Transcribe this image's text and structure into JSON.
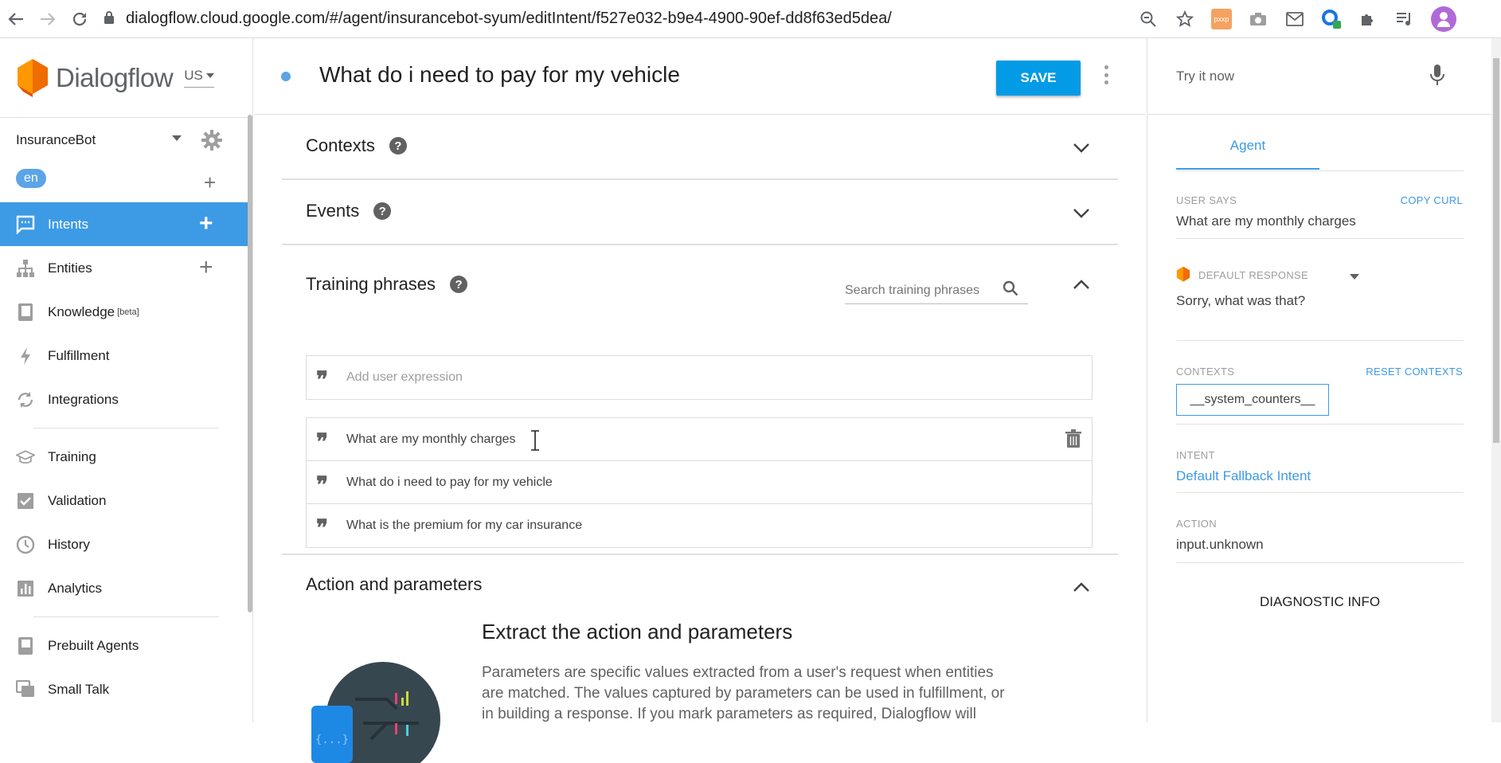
{
  "browser": {
    "url": "dialogflow.cloud.google.com/#/agent/insurancebot-syum/editIntent/f527e032-b9e4-4900-90ef-dd8f63ed5dea/",
    "ext_label": "pxxp"
  },
  "sidebar": {
    "logo": "Dialogflow",
    "region": "US",
    "agent": "InsuranceBot",
    "language": "en",
    "items": [
      {
        "label": "Intents",
        "active": true
      },
      {
        "label": "Entities"
      },
      {
        "label": "Knowledge",
        "sup": "[beta]"
      },
      {
        "label": "Fulfillment"
      },
      {
        "label": "Integrations"
      },
      {
        "label": "Training"
      },
      {
        "label": "Validation"
      },
      {
        "label": "History"
      },
      {
        "label": "Analytics"
      },
      {
        "label": "Prebuilt Agents"
      },
      {
        "label": "Small Talk"
      }
    ]
  },
  "main": {
    "intent_title": "What do i need to pay for my vehicle",
    "save_label": "SAVE",
    "sections": {
      "contexts": "Contexts",
      "events": "Events",
      "training": "Training phrases",
      "action": "Action and parameters"
    },
    "search_placeholder": "Search training phrases",
    "add_placeholder": "Add user expression",
    "phrases": [
      "What are my monthly charges",
      "What do i need to pay for my vehicle",
      "What is the premium for my car insurance"
    ],
    "ap_heading": "Extract the action and parameters",
    "ap_text": "Parameters are specific values extracted from a user's request when entities are matched. The values captured by parameters can be used in fulfillment, or in building a response. If you mark parameters as required, Dialogflow will"
  },
  "rpanel": {
    "try_placeholder": "Try it now",
    "tab": "Agent",
    "user_says_label": "USER SAYS",
    "copy_curl": "COPY CURL",
    "user_says": "What are my monthly charges",
    "default_response_label": "DEFAULT RESPONSE",
    "default_response": "Sorry, what was that?",
    "contexts_label": "CONTEXTS",
    "reset_contexts": "RESET CONTEXTS",
    "context_chip": "__system_counters__",
    "intent_label": "INTENT",
    "intent_value": "Default Fallback Intent",
    "action_label": "ACTION",
    "action_value": "input.unknown",
    "diagnostic": "DIAGNOSTIC INFO"
  },
  "colors": {
    "accent": "#3d9ae5",
    "save": "#039be5",
    "logo_orange": "#ef6c00"
  }
}
